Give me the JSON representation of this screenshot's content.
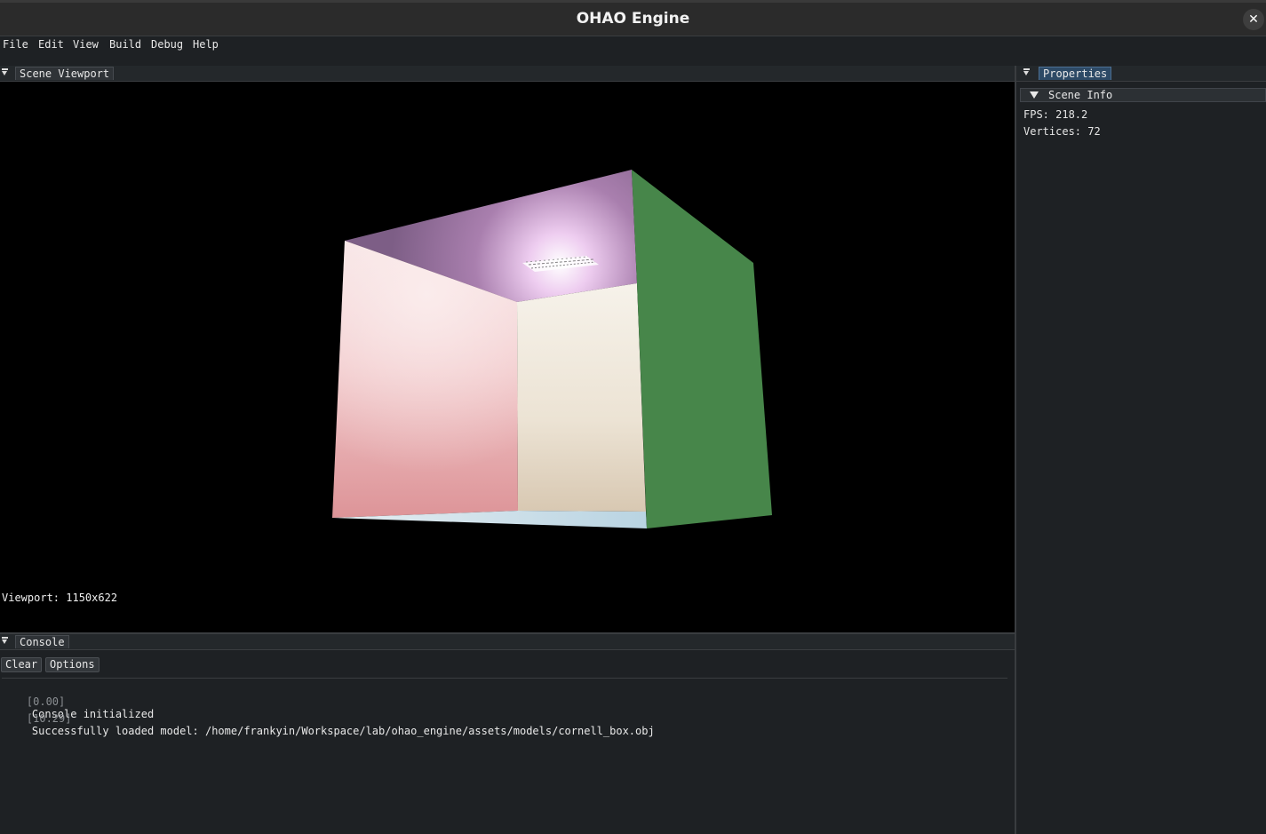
{
  "window": {
    "title": "OHAO Engine",
    "close_glyph": "✕"
  },
  "menu": [
    "File",
    "Edit",
    "View",
    "Build",
    "Debug",
    "Help"
  ],
  "viewport_panel": {
    "tab_label": "Scene Viewport",
    "info_label": "Viewport: 1150x622",
    "scene": {
      "description_object": "cornell-box",
      "colors": {
        "left_wall": "#eab0b3",
        "back_wall": "#eee6d8",
        "right_wall": "#47864a",
        "ceiling": "#8f6b96",
        "floor": "#c7dce6"
      }
    }
  },
  "properties_panel": {
    "tab_label": "Properties",
    "section_label": "Scene Info",
    "fps_line": "FPS: 218.2",
    "vertices_line": "Vertices: 72"
  },
  "console_panel": {
    "tab_label": "Console",
    "clear_label": "Clear",
    "options_label": "Options",
    "logs": [
      {
        "time": "[0.00]",
        "message": "Console initialized"
      },
      {
        "time": "[10.29]",
        "message": "Successfully loaded model: /home/frankyin/Workspace/lab/ohao_engine/assets/models/cornell_box.obj"
      }
    ]
  },
  "icons": {
    "panel_collapse": "collapse-icon",
    "section_arrow": "triangle-down-icon",
    "close": "close-icon"
  }
}
